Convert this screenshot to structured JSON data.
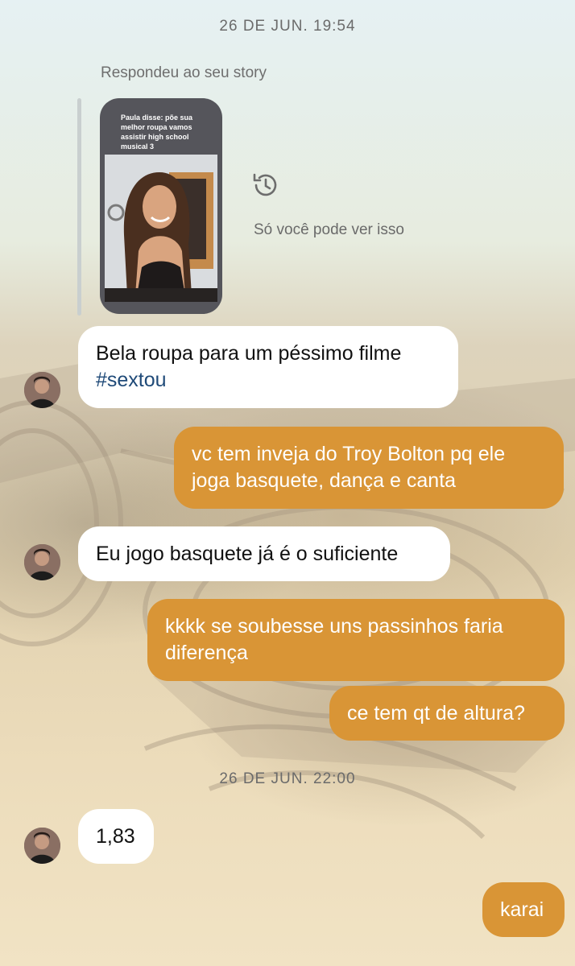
{
  "timestamps": [
    "26 DE JUN. 19:54",
    "26 DE JUN. 22:00"
  ],
  "story_reply": {
    "label": "Respondeu ao seu story",
    "story_caption": "Paula disse: põe sua melhor roupa vamos assistir high school musical 3",
    "visibility_icon": "history-icon",
    "visibility_note": "Só você pode ver isso"
  },
  "messages": [
    {
      "from": "them",
      "text": "Bela roupa para um péssimo filme",
      "hashtag": "#sextou"
    },
    {
      "from": "me",
      "text": "vc tem inveja do Troy Bolton pq ele joga basquete, dança e canta"
    },
    {
      "from": "them",
      "text": "Eu jogo basquete já é o suficiente"
    },
    {
      "from": "me",
      "text": "kkkk se soubesse uns passinhos faria diferença"
    },
    {
      "from": "me",
      "text": "ce tem qt de altura?"
    },
    {
      "from": "them",
      "text": "1,83"
    },
    {
      "from": "me",
      "text": "karai"
    }
  ],
  "colors": {
    "outgoing_bubble": "#d99536",
    "incoming_bubble": "#ffffff",
    "hashtag": "#1f4a78"
  }
}
